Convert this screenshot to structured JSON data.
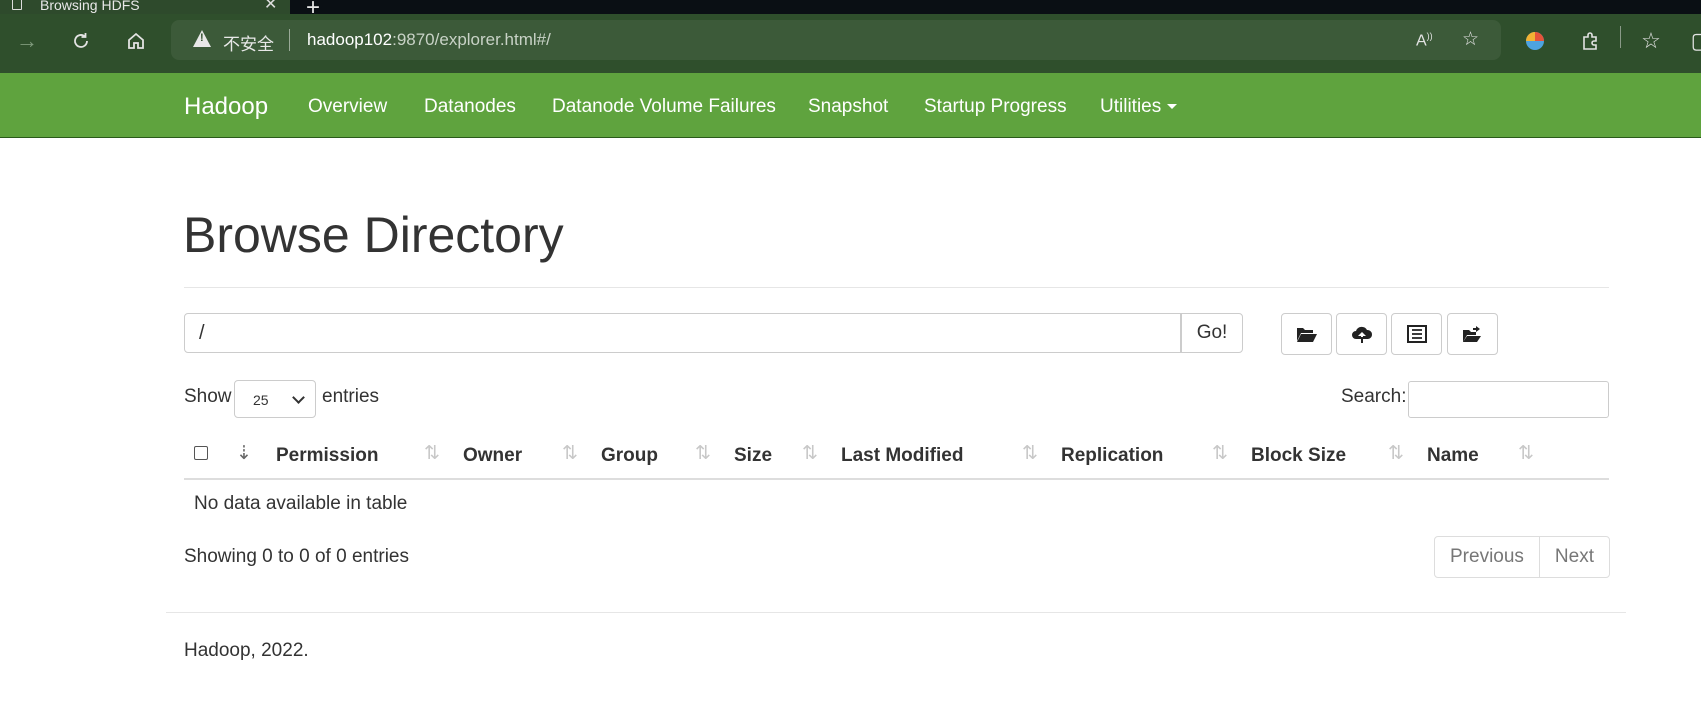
{
  "browser": {
    "tab_title": "Browsing HDFS",
    "security_label": "不安全",
    "url_host": "hadoop102",
    "url_rest": ":9870/explorer.html#/"
  },
  "navbar": {
    "brand": "Hadoop",
    "items": [
      "Overview",
      "Datanodes",
      "Datanode Volume Failures",
      "Snapshot",
      "Startup Progress",
      "Utilities"
    ]
  },
  "page": {
    "title": "Browse Directory",
    "path_value": "/",
    "go_label": "Go!"
  },
  "table_controls": {
    "show_label": "Show",
    "page_size": "25",
    "entries_label": "entries",
    "search_label": "Search:"
  },
  "table": {
    "columns": [
      "Permission",
      "Owner",
      "Group",
      "Size",
      "Last Modified",
      "Replication",
      "Block Size",
      "Name"
    ],
    "empty_message": "No data available in table",
    "info": "Showing 0 to 0 of 0 entries",
    "previous_label": "Previous",
    "next_label": "Next"
  },
  "footer": {
    "text": "Hadoop, 2022."
  },
  "colors": {
    "navbar": "#5fa33e",
    "toolbar": "#2f4f2c"
  }
}
